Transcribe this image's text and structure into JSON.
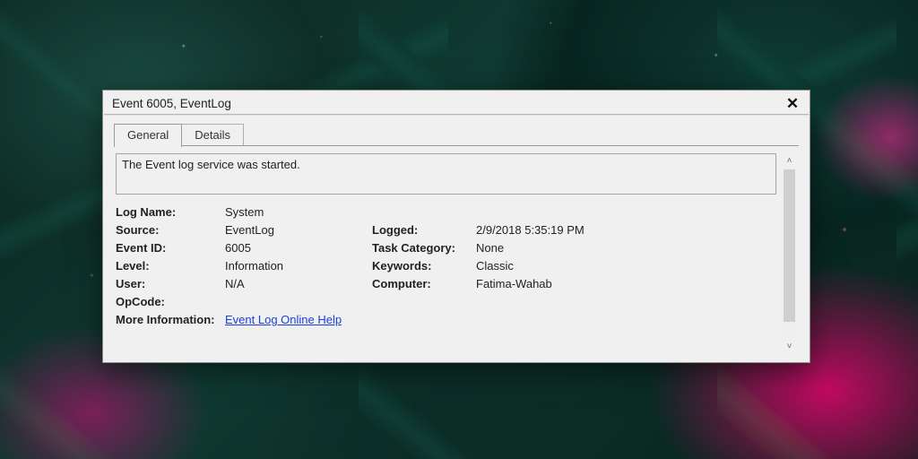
{
  "dialog": {
    "title": "Event 6005, EventLog",
    "tabs": {
      "general": "General",
      "details": "Details"
    },
    "description": "The Event log service was started.",
    "labels": {
      "log_name": "Log Name:",
      "source": "Source:",
      "event_id": "Event ID:",
      "level": "Level:",
      "user": "User:",
      "opcode": "OpCode:",
      "more_info": "More Information:",
      "logged": "Logged:",
      "task_category": "Task Category:",
      "keywords": "Keywords:",
      "computer": "Computer:"
    },
    "values": {
      "log_name": "System",
      "source": "EventLog",
      "event_id": "6005",
      "level": "Information",
      "user": "N/A",
      "opcode": "",
      "logged": "2/9/2018 5:35:19 PM",
      "task_category": "None",
      "keywords": "Classic",
      "computer": "Fatima-Wahab"
    },
    "link": "Event Log Online Help"
  }
}
